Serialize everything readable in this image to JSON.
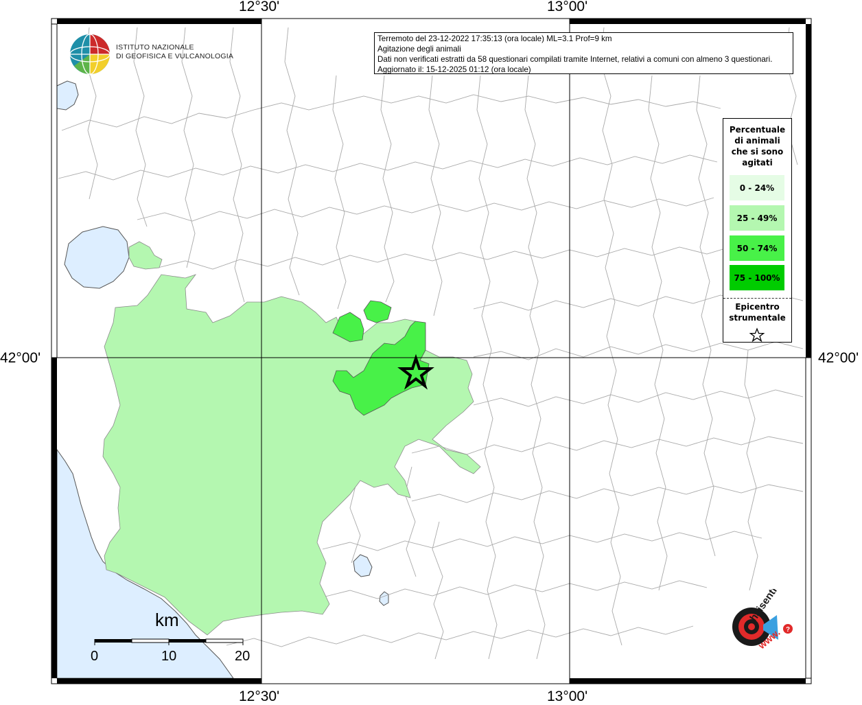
{
  "header": {
    "info_line1": "Terremoto del 23-12-2022 17:35:13 (ora locale) ML=3.1 Prof=9 km",
    "info_line2": "Agitazione degli animali",
    "info_line3": "Dati non verificati estratti da 58 questionari compilati tramite Internet, relativi a comuni con almeno 3 questionari.",
    "info_line4": "Aggiornato il: 15-12-2025 01:12 (ora locale)"
  },
  "institute": {
    "line1": "ISTITUTO NAZIONALE",
    "line2": "DI GEOFISICA E VULCANOLOGIA"
  },
  "coords": {
    "top_left": "12°30'",
    "top_right": "13°00'",
    "bottom_left": "12°30'",
    "bottom_right": "13°00'",
    "left": "42°00'",
    "right": "42°00'"
  },
  "legend": {
    "title": "Percentuale di animali che si sono agitati",
    "title_lines": [
      "Percentuale",
      "di animali",
      "che si sono",
      "agitati"
    ],
    "classes": [
      {
        "label": "0 - 24%",
        "color": "#e5fce5"
      },
      {
        "label": "25 - 49%",
        "color": "#b4f7b0"
      },
      {
        "label": "50 - 74%",
        "color": "#48f148"
      },
      {
        "label": "75 - 100%",
        "color": "#00cc00"
      }
    ],
    "epicentre_line1": "Epicentro",
    "epicentre_line2": "strumentale",
    "epicentre_icon": "star-icon"
  },
  "scalebar": {
    "unit": "km",
    "labels": [
      "0",
      "10",
      "20"
    ]
  },
  "logo_text": {
    "brand": "haisentitoilterremoto.it",
    "www": "www."
  },
  "colors": {
    "sea": "#ddeeff",
    "area_25_49": "#b4f7b0",
    "area_50_74": "#48f148",
    "frame": "#000000"
  }
}
